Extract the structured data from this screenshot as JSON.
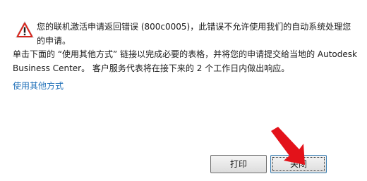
{
  "dialog": {
    "error_message": "您的联机激活申请返回错误 (800c0005)，此错误不允许使用我们的自动系统处理您的申请。",
    "info_message": "单击下面的 “使用其他方式” 链接以完成必要的表格，并将您的申请提交给当地的 Autodesk Business Center。 客户服务代表将在接下来的 2 个工作日内做出响应。",
    "alt_method_link": "使用其他方式",
    "print_button": "打印",
    "close_button": "关闭"
  },
  "colors": {
    "link": "#1e6fb8",
    "warning_red": "#d9251c",
    "arrow_red": "#e3121a"
  },
  "icons": {
    "warning": "warning-icon",
    "annotation": "red-arrow-annotation"
  }
}
